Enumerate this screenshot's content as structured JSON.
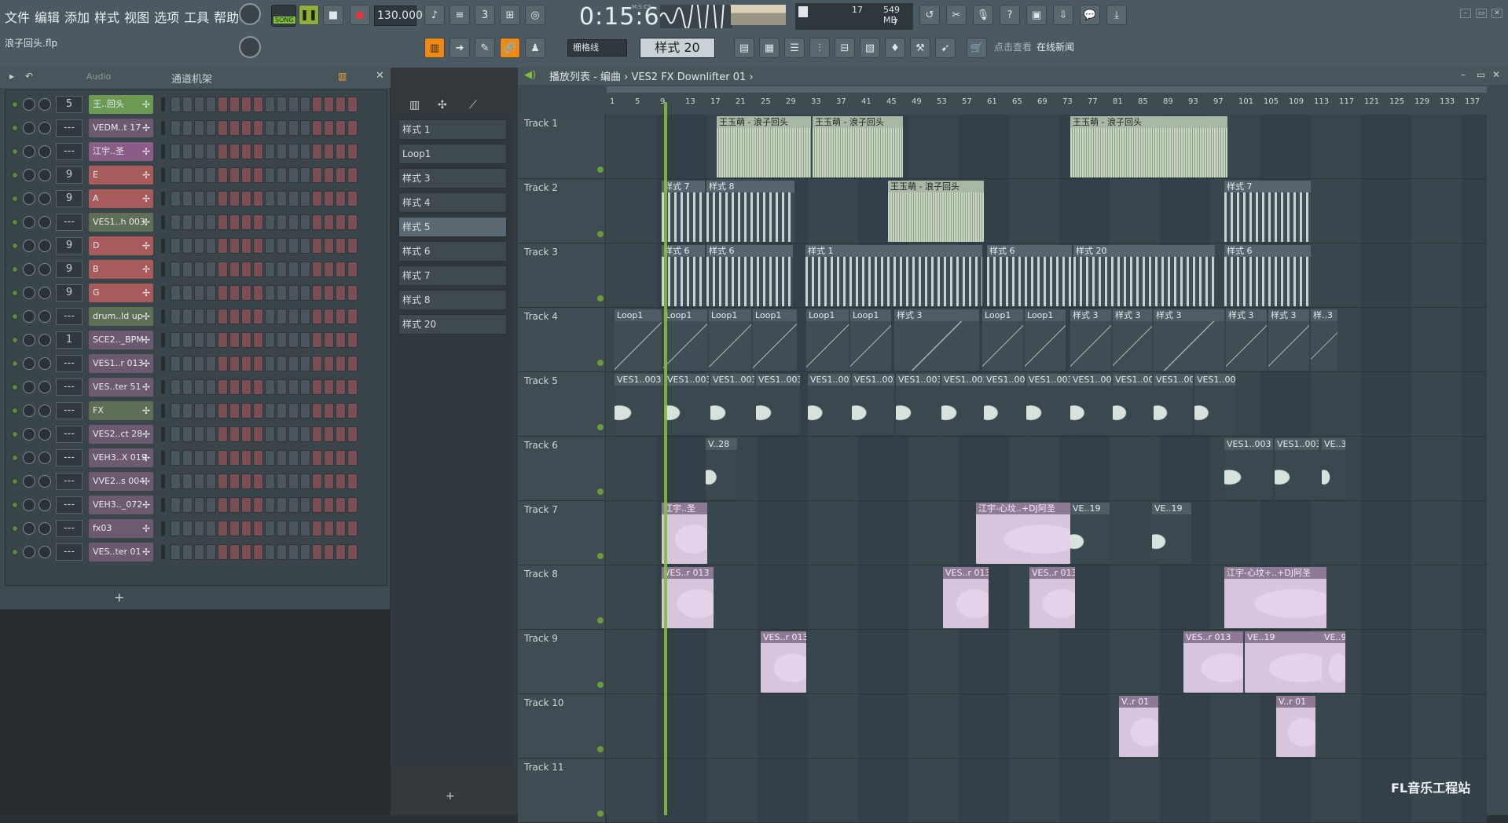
{
  "menu": [
    "文件",
    "编辑",
    "添加",
    "样式",
    "视图",
    "选项",
    "工具",
    "帮助"
  ],
  "project_name": "浪子回头.flp",
  "transport": {
    "song_label": "SONG",
    "tempo": "130.000",
    "time": "0:15:60",
    "time_unit": "M:S:CS"
  },
  "cpu": {
    "value": "17",
    "memory": "549 MB",
    "polyphony": "7"
  },
  "toolbar2": {
    "snap": "栅格线",
    "pattern": "样式 20"
  },
  "hint": {
    "label": "点击查看",
    "link": "在线新闻"
  },
  "rack": {
    "filter": "Audio",
    "title": "通道机架"
  },
  "channels": [
    {
      "num": "5",
      "name": "王..回头",
      "color": "#6d9a53"
    },
    {
      "num": "---",
      "name": "VEDM..t 17",
      "color": "#6d5a70"
    },
    {
      "num": "---",
      "name": "江宇..圣",
      "color": "#8a5c88"
    },
    {
      "num": "9",
      "name": "E",
      "color": "#a95a5a"
    },
    {
      "num": "9",
      "name": "A",
      "color": "#a95a5a"
    },
    {
      "num": "---",
      "name": "VES1..h 003",
      "color": "#5e6f55"
    },
    {
      "num": "9",
      "name": "D",
      "color": "#a95a5a"
    },
    {
      "num": "9",
      "name": "B",
      "color": "#a95a5a"
    },
    {
      "num": "9",
      "name": "G",
      "color": "#a95a5a"
    },
    {
      "num": "---",
      "name": "drum..ld up",
      "color": "#5e6f55"
    },
    {
      "num": "1",
      "name": "SCE2.._BPM",
      "color": "#6d5a70"
    },
    {
      "num": "---",
      "name": "VES1..r 013",
      "color": "#6d5a70"
    },
    {
      "num": "---",
      "name": "VES..ter 51",
      "color": "#6d5a70"
    },
    {
      "num": "---",
      "name": "FX",
      "color": "#5e6f55"
    },
    {
      "num": "---",
      "name": "VES2..ct 28",
      "color": "#6d5a70"
    },
    {
      "num": "---",
      "name": "VEH3..X 019",
      "color": "#6d5a70"
    },
    {
      "num": "---",
      "name": "VVE2..s 004",
      "color": "#6d5a70"
    },
    {
      "num": "---",
      "name": "VEH3.._072",
      "color": "#6d5a70"
    },
    {
      "num": "---",
      "name": "fx03",
      "color": "#6d5a70"
    },
    {
      "num": "---",
      "name": "VES..ter 01",
      "color": "#6d5a70"
    }
  ],
  "picker": [
    "样式 1",
    "Loop1",
    "样式 3",
    "样式 4",
    "样式 5",
    "样式 6",
    "样式 7",
    "样式 8",
    "样式 20"
  ],
  "playlist": {
    "title": "播放列表 - 编曲",
    "current": "VES2 FX Downlifter 01"
  },
  "ruler": [
    "1",
    "5",
    "9",
    "13",
    "17",
    "21",
    "25",
    "29",
    "33",
    "37",
    "41",
    "45",
    "49",
    "53",
    "57",
    "61",
    "65",
    "69",
    "73",
    "77",
    "81",
    "85",
    "89",
    "93",
    "97",
    "101",
    "105",
    "109",
    "113",
    "117",
    "121",
    "125",
    "129",
    "133",
    "137"
  ],
  "tracks": [
    "Track 1",
    "Track 2",
    "Track 3",
    "Track 4",
    "Track 5",
    "Track 6",
    "Track 7",
    "Track 8",
    "Track 9",
    "Track 10",
    "Track 11"
  ],
  "clips": {
    "t1": [
      "王玉萌 - 浪子回头",
      "王玉萌 - 浪子回头",
      "王玉萌 - 浪子回头"
    ],
    "t2": [
      "样式 7",
      "样式 8",
      "王玉萌 - 浪子回头",
      "样式 7"
    ],
    "t3": [
      "样式 6",
      "样式 6",
      "样式 1",
      "样式 6",
      "样式 20",
      "样式 6"
    ],
    "t4": [
      "Loop1",
      "Loop1",
      "Loop1",
      "Loop1",
      "Loop1",
      "Loop1",
      "样式 3",
      "Loop1",
      "Loop1",
      "样式 3",
      "样式 3",
      "样式 3",
      "样式 3",
      "样式 3",
      "样..3"
    ],
    "t5": [
      "VES1..003",
      "VES1..003",
      "VES1..003",
      "VES1..003",
      "VES1..003",
      "VES1..003",
      "VES1..003",
      "VES1..003",
      "VES1..003",
      "VES1..003",
      "VES1..003",
      "VES1..003",
      "VES1..003",
      "VES1..003"
    ],
    "t6": [
      "V..28",
      "VES1..003",
      "VES1..003",
      "VE..3"
    ],
    "t7": [
      "江宇..圣",
      "江宇-心坟..+DJ阿圣",
      "VE..19",
      "VE..19"
    ],
    "t8": [
      "VES..r 013",
      "VES..r 013",
      "VES..r 013",
      "江宇-心坟+..+DJ阿圣"
    ],
    "t9": [
      "VES..r 013",
      "VES..r 013",
      "VE..19",
      "VE..9"
    ],
    "t10": [
      "V..r 01",
      "V..r 01"
    ]
  },
  "watermark": "FL音乐工程站"
}
